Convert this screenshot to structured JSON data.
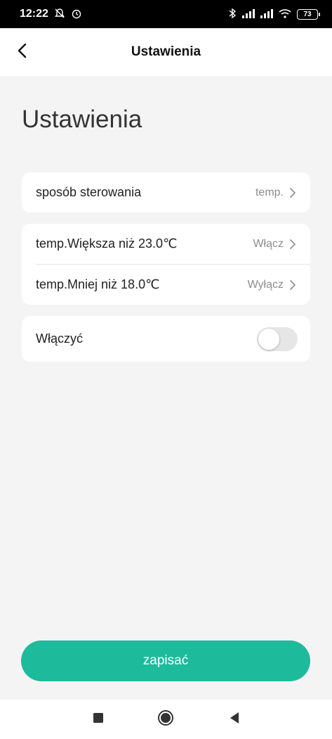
{
  "status_bar": {
    "time": "12:22",
    "battery": "73",
    "icons": [
      "notifications-off-icon",
      "alarm-icon",
      "bluetooth-icon",
      "signal-icon",
      "signal-icon",
      "wifi-icon",
      "battery-icon"
    ]
  },
  "header": {
    "title": "Ustawienia",
    "back_icon": "back-arrow-icon"
  },
  "page": {
    "title": "Ustawienia"
  },
  "settings": {
    "control_mode": {
      "label": "sposób sterowania",
      "value": "temp."
    },
    "rules": [
      {
        "label": "temp.Większa niż 23.0℃",
        "value": "Włącz"
      },
      {
        "label": "temp.Mniej niż 18.0℃",
        "value": "Wyłącz"
      }
    ],
    "enable": {
      "label": "Włączyć",
      "on": false
    }
  },
  "actions": {
    "save_label": "zapisać"
  },
  "colors": {
    "accent": "#1dbb9c",
    "background": "#f4f4f4",
    "card": "#ffffff",
    "muted_text": "#8d8d8d"
  },
  "nav": {
    "icons": [
      "recent-apps-icon",
      "home-icon",
      "back-icon"
    ]
  }
}
